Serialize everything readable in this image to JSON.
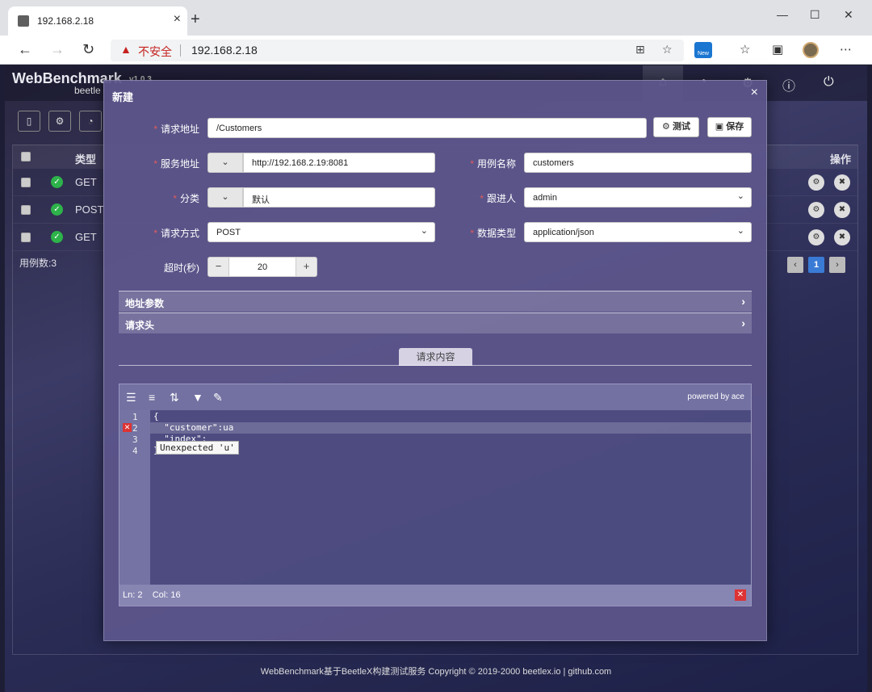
{
  "browser": {
    "tab_title": "192.168.2.18",
    "close_tab": "×",
    "new_tab": "+",
    "minimize": "—",
    "maximize": "☐",
    "close_window": "✕",
    "back": "←",
    "forward": "→",
    "refresh": "↻",
    "security_warning": "不安全",
    "url": "192.168.2.18",
    "new_badge": "New"
  },
  "app": {
    "brand": "WebBenchmark",
    "version": "v1.0.3",
    "subtitle": "beetle",
    "footer": "WebBenchmark基于BeetleX构建测试服务 Copyright © 2019-2000 beetlex.io | github.com",
    "count_label": "用例数:3",
    "page_current": "1"
  },
  "background_table": {
    "headers": {
      "type": "类型",
      "actions": "操作"
    },
    "rows": [
      {
        "method": "GET"
      },
      {
        "method": "POST"
      },
      {
        "method": "GET"
      }
    ]
  },
  "modal": {
    "title": "新建",
    "close": "×",
    "fields": {
      "request_url_label": "请求地址",
      "request_url_value": "/Customers",
      "test_button": "测试",
      "save_button": "保存",
      "service_url_label": "服务地址",
      "service_url_value": "http://192.168.2.19:8081",
      "case_name_label": "用例名称",
      "case_name_value": "customers",
      "category_label": "分类",
      "category_value": "默认",
      "follower_label": "跟进人",
      "follower_value": "admin",
      "method_label": "请求方式",
      "method_value": "POST",
      "data_type_label": "数据类型",
      "data_type_value": "application/json",
      "timeout_label": "超时(秒)",
      "timeout_value": "20",
      "minus": "−",
      "plus": "+"
    },
    "sections": {
      "url_params": "地址参数",
      "headers": "请求头"
    },
    "tab_request_body": "请求内容"
  },
  "editor": {
    "powered_by": "powered by ace",
    "lines": [
      "1",
      "2",
      "3",
      "4"
    ],
    "code": [
      "{",
      "  \"customer\":ua",
      "  \"index\":",
      "}"
    ],
    "error_tooltip": "Unexpected 'u'",
    "status_ln": "Ln: 2",
    "status_col": "Col: 16"
  }
}
